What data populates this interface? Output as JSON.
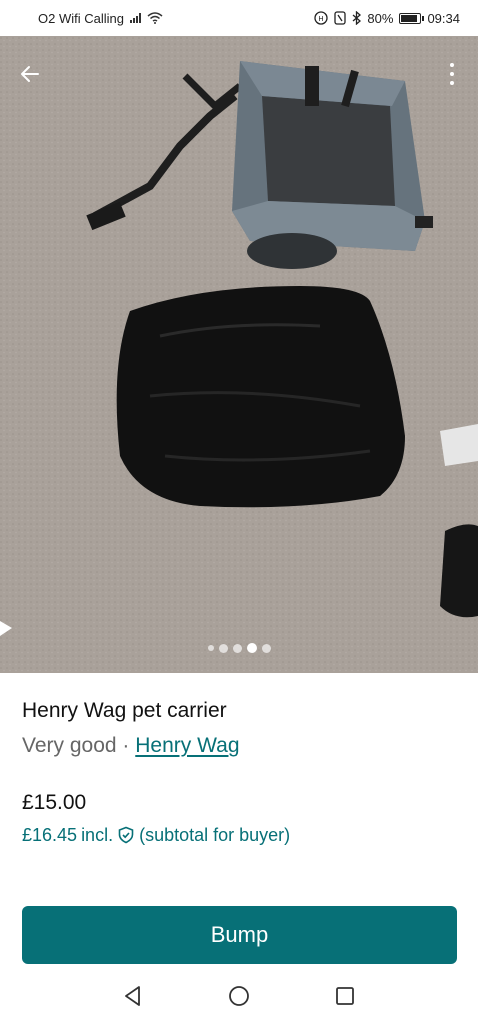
{
  "status_bar": {
    "carrier": "O2 Wifi Calling",
    "battery": "80%",
    "time": "09:34"
  },
  "photo": {
    "back_icon": "arrow-left-icon",
    "more_icon": "more-vertical-icon",
    "carousel_count": 5,
    "carousel_active": 3
  },
  "listing": {
    "title": "Henry Wag pet carrier",
    "condition": "Very good",
    "separator": "·",
    "brand": "Henry Wag",
    "price": "£15.00",
    "buyer_price": "£16.45",
    "incl_label": "incl.",
    "buyer_note": "(subtotal for buyer)"
  },
  "actions": {
    "bump_label": "Bump"
  },
  "colors": {
    "accent": "#077077",
    "text": "#111111",
    "muted": "#666666"
  },
  "nav": {
    "back_icon": "nav-back-icon",
    "home_icon": "nav-home-icon",
    "recents_icon": "nav-recents-icon"
  }
}
